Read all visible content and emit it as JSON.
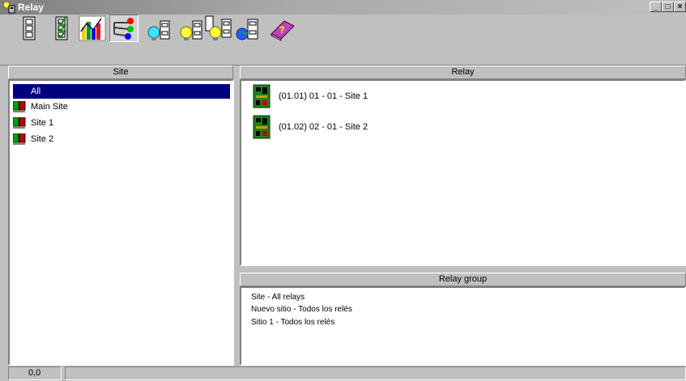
{
  "window": {
    "title": "Relay",
    "min_label": "_",
    "max_label": "□",
    "close_label": "×"
  },
  "toolbar": {
    "buttons": [
      {
        "icon": "list-view-icon"
      },
      {
        "icon": "checklist-icon"
      },
      {
        "icon": "chart-icon"
      },
      {
        "icon": "network-icon",
        "pressed": true
      },
      {
        "icon": "bulb-relay-icon"
      },
      {
        "icon": "bulb-relay-icon"
      },
      {
        "icon": "bulb-relay-multi-icon"
      },
      {
        "icon": "relay-globe-icon"
      },
      {
        "icon": "help-book-icon"
      }
    ]
  },
  "site_panel": {
    "header": "Site",
    "items": [
      {
        "label": "All",
        "selected": true
      },
      {
        "label": "Main Site"
      },
      {
        "label": "Site 1"
      },
      {
        "label": "Site 2"
      }
    ]
  },
  "relay_panel": {
    "header": "Relay",
    "items": [
      {
        "label": "(01.01) 01 - 01 - Site 1"
      },
      {
        "label": "(01.02) 02 - 01 - Site 2"
      }
    ]
  },
  "group_panel": {
    "header": "Relay group",
    "items": [
      {
        "label": "Site - All relays"
      },
      {
        "label": "Nuevo sitio - Todos los relés"
      },
      {
        "label": "Sitio 1 - Todos los relés"
      }
    ]
  },
  "status": {
    "coords": "0,0"
  }
}
